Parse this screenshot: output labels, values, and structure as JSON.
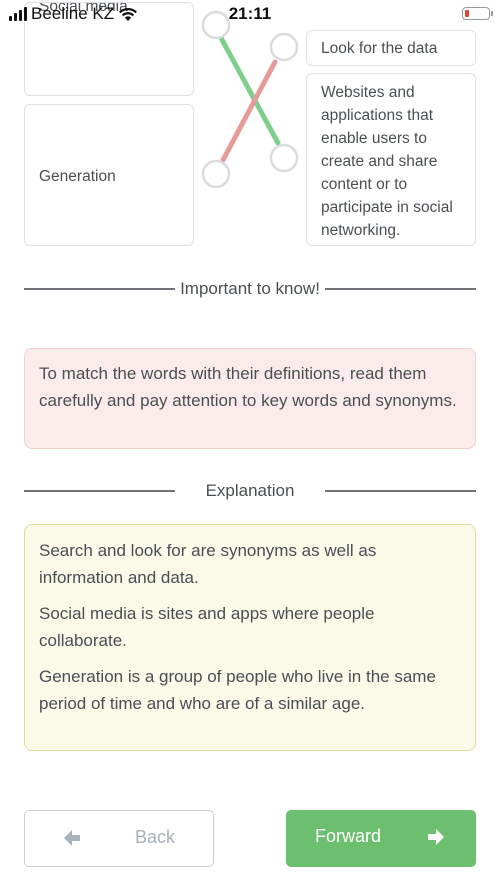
{
  "status_bar": {
    "carrier": "Beeline KZ",
    "time": "21:11",
    "battery_level_percent": 10
  },
  "matching": {
    "left_items": [
      {
        "label": "Social media"
      },
      {
        "label": "Generation"
      }
    ],
    "right_items": [
      {
        "label": "Look for the data"
      },
      {
        "label": "Websites and applications that enable users to create and share content or to participate in social networking."
      }
    ],
    "connections": [
      {
        "from": "Social media",
        "to": "Websites and applications that enable users to create and share content or to participate in social networking.",
        "result": "correct",
        "color": "#7fcf8c"
      },
      {
        "from": "Generation",
        "to": "Look for the data",
        "result": "incorrect",
        "color": "#e79a9a"
      }
    ]
  },
  "important": {
    "heading": "Important to know!",
    "text": "To match the words with their definitions, read them carefully and pay attention to key words and synonyms."
  },
  "explanation": {
    "heading": "Explanation",
    "paragraphs": [
      "Search and look for are synonyms as well as information and data.",
      "Social media is sites and apps where people collaborate.",
      "Generation is a group of people who live in the same period of time and who are of a similar age."
    ]
  },
  "navigation": {
    "back_label": "Back",
    "forward_label": "Forward",
    "back_icon": "arrow-left-icon",
    "forward_icon": "arrow-right-icon",
    "forward_color": "#6cbf6e"
  }
}
